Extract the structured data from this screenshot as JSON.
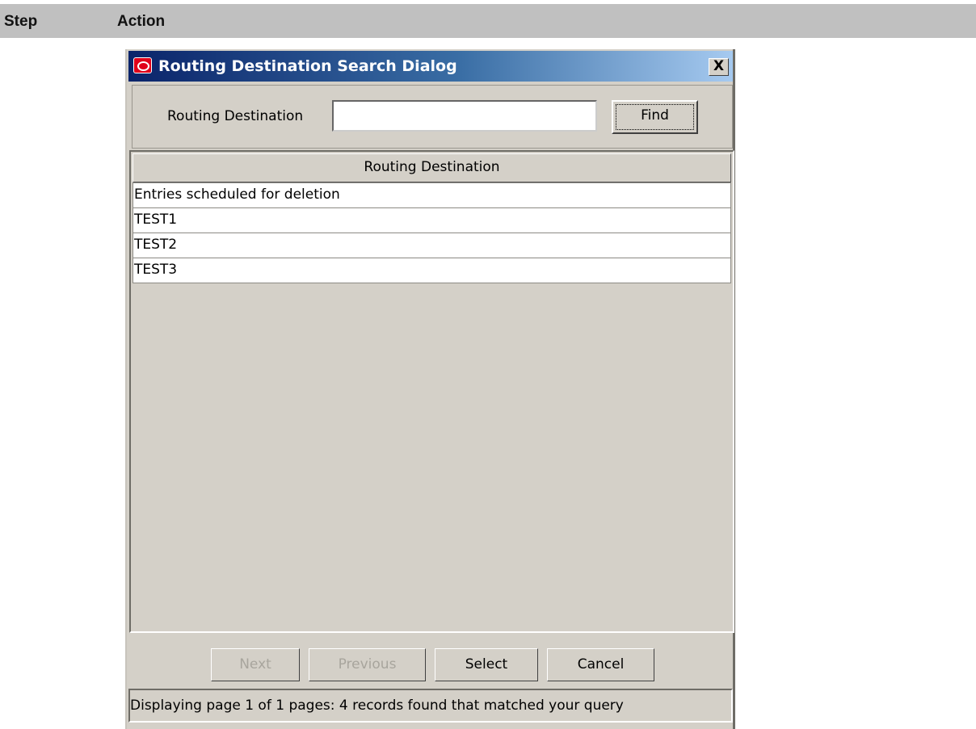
{
  "header": {
    "step": "Step",
    "action": "Action"
  },
  "dialog": {
    "title": "Routing Destination Search Dialog",
    "close_label": "X",
    "search": {
      "label": "Routing Destination",
      "value": "",
      "find_label": "Find"
    },
    "table": {
      "column_header": "Routing Destination",
      "rows": [
        "Entries scheduled for deletion",
        "TEST1",
        "TEST2",
        "TEST3"
      ]
    },
    "buttons": {
      "next": {
        "label": "Next",
        "enabled": false
      },
      "previous": {
        "label": "Previous",
        "enabled": false
      },
      "select": {
        "label": "Select",
        "enabled": true
      },
      "cancel": {
        "label": "Cancel",
        "enabled": true
      }
    },
    "status": "Displaying page 1 of 1 pages:   4 records found that matched your query"
  }
}
